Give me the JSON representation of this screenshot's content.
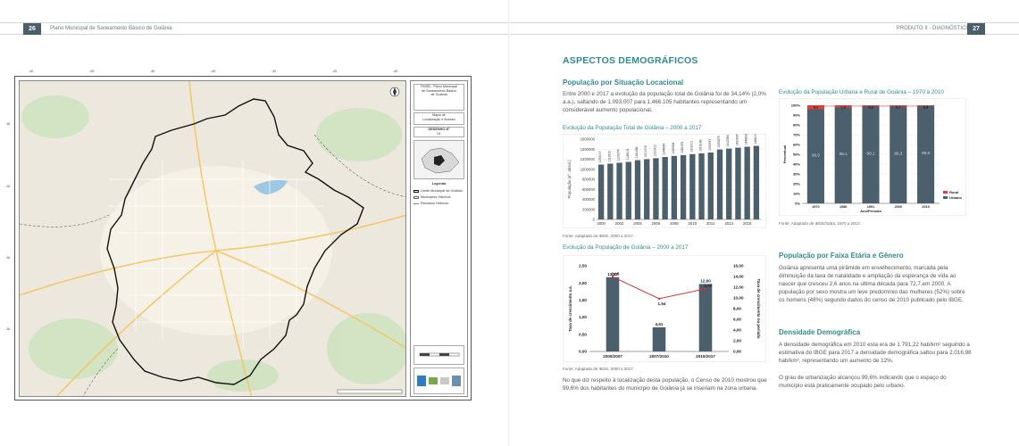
{
  "left_page": {
    "page_number": "26",
    "header_title": "Plano Municipal de Saneamento Básico de Goiânia",
    "map": {
      "top_coords": [
        "-49",
        "-49",
        "-49",
        "-49",
        "-49",
        "-49",
        "-49"
      ],
      "side_coords": [
        "-16",
        "-16",
        "-16",
        "-16"
      ],
      "legend_title_lines": [
        "PMSB - Plano Municipal",
        "de Saneamento Básico",
        "de Goiânia"
      ],
      "map_name_lines": [
        "Mapa de",
        "Localização e Acesso"
      ],
      "drawing_label": "DESENHO Nº",
      "drawing_number": "01",
      "legend_heading": "Legenda",
      "legend_items": [
        "Limite Municipal de Goiânia",
        "Municípios Vizinhos",
        "Recursos Hídricos"
      ]
    }
  },
  "right_page": {
    "page_number": "27",
    "header_title": "PRODUTO II - DIAGNÓSTICO",
    "section_title": "ASPECTOS DEMOGRÁFICOS",
    "subtitle_situacao": "População por Situação Locacional",
    "para_situacao": "Entre 2000 e 2017 a evolução da população total de Goiânia foi de 34,14% (2,0% a.a.), saltando de 1.093.007 para 1.466.105 habitantes representando um considerável aumento populacional.",
    "chart1_title": "Evolução da População Total de Goiânia – 2000 a 2017",
    "chart1_source": "Fonte: Adaptado de IBGE, 2000 a 2017.",
    "chart2_title": "Evolução da População de Goiânia – 2000 a 2017",
    "chart2_source": "Fonte: Adaptado de IBGE, 2000 a 2017.",
    "para_censo": "No que diz respeito à localização desta população, o Censo de 2010 mostrou que 99,6% dos habitantes do município de Goiânia já se inseriam na zona urbana.",
    "chart3_title": "Evolução da População Urbana e Rural de Goiânia – 1970 a 2010",
    "chart3_source": "Fonte: Adaptado de IBGE/Sidra, 1970 a 2010.",
    "subtitle_faixa": "População por Faixa Etária e Gênero",
    "para_faixa": "Goiânia apresenta uma pirâmide em envelhecimento, marcada pela diminuição da taxa de natalidade e ampliação da esperança de vida ao nascer que cresceu 2,6 anos na última década para 72,7,em 2000. A população por sexo mostra um leve predomínio das mulheres (52%) sobre os homens (48%) segundo dados do censo de 2010 publicado pelo IBGE.",
    "subtitle_densidade": "Densidade Demográfica",
    "para_densidade": "A densidade demográfica em 2010 esta era de 1.791,22 hab/km² seguindo a estimativa do IBGE para 2017 a densidade demográfica saltou para 2.016,98 hab/km², representando um aumento de 12%.",
    "para_urbanizacao": "O grau de urbanização alcançou 99,6% indicando que o espaço do município está praticamente ocupado pelo urbano."
  },
  "colors": {
    "accent": "#2f8b8c",
    "bar": "#4b5f6c",
    "line": "#d9322d",
    "rural": "#d94040",
    "header_box": "#4a5f69"
  },
  "chart_data": [
    {
      "type": "bar",
      "title": "Evolução da População Total de Goiânia – 2000 a 2017",
      "ylabel": "População (nº. absol.)",
      "ylim": [
        0,
        1600000
      ],
      "yticks": [
        "1600000",
        "1400000",
        "1200000",
        "1000000",
        "800000",
        "600000",
        "400000",
        "200000",
        "0"
      ],
      "x_tick_labels": [
        "2000",
        "2002",
        "2004",
        "2006",
        "2008",
        "2010",
        "2012",
        "2014",
        "2016"
      ],
      "categories": [
        "2000",
        "2001",
        "2002",
        "2003",
        "2004",
        "2005",
        "2006",
        "2007",
        "2008",
        "2009",
        "2010",
        "2011",
        "2012",
        "2013",
        "2014",
        "2015",
        "2016",
        "2017"
      ],
      "values": [
        1093007,
        1111622,
        1129274,
        1146106,
        1181438,
        1201006,
        1220412,
        1244645,
        1265394,
        1281975,
        1302001,
        1318148,
        1333767,
        1393579,
        1412364,
        1430697,
        1448639,
        1466105
      ],
      "value_labels": [
        "1093007",
        "1111622",
        "1129274",
        "1146106",
        "1181438",
        "1201006",
        "1220412",
        "1244645",
        "1265394",
        "1281975",
        "1302001",
        "1318148",
        "1333767",
        "1393579",
        "1412364",
        "1430697",
        "1448639",
        "1466105"
      ]
    },
    {
      "type": "bar",
      "title": "Evolução da População de Goiânia – 2000 a 2017",
      "categories": [
        "2000/2007",
        "2007/2010",
        "2010/2017"
      ],
      "bar_values": [
        13.87,
        4.51,
        12.6
      ],
      "bar_labels": [
        "13,87",
        "4,51",
        "12,60"
      ],
      "line_values": [
        2.18,
        1.54,
        1.83
      ],
      "line_labels": [
        "2,18",
        "1,54",
        "1,83"
      ],
      "left_axis_label": "Taxa de crescimento a.a.",
      "right_axis_label": "Taxa de crescimento no período",
      "left_ticks": [
        "2,50",
        "2,00",
        "1,50",
        "1,00",
        "0,50",
        "0,00"
      ],
      "right_ticks": [
        "16,00",
        "14,00",
        "12,00",
        "10,00",
        "8,00",
        "6,00",
        "4,00",
        "2,00",
        "0,00"
      ],
      "left_ylim": [
        0,
        2.5
      ],
      "right_ylim": [
        0,
        16
      ]
    },
    {
      "type": "bar",
      "title": "Evolução da População Urbana e Rural de Goiânia – 1970 a 2010",
      "stacked": true,
      "categories": [
        "1970",
        "1980",
        "1991",
        "2000",
        "2010"
      ],
      "xlabel": "Ano/Período",
      "ylabel": "Percentual",
      "yticks": [
        "100%",
        "90%",
        "80%",
        "70%",
        "60%",
        "50%",
        "40%",
        "30%",
        "20%",
        "10%",
        "0%"
      ],
      "series": [
        {
          "name": "Urbano",
          "values": [
            95.9,
            98.1,
            99.1,
            99.3,
            99.6
          ],
          "labels": [
            "95,9",
            "98,1",
            "99,1",
            "99,3",
            "99,6"
          ]
        },
        {
          "name": "Rural",
          "values": [
            4.1,
            1.9,
            0.9,
            0.7,
            0.4
          ],
          "labels": [
            "4,1",
            "1,9",
            "0,9",
            "0,7",
            "0,4"
          ]
        }
      ],
      "legend_position": "right"
    }
  ]
}
